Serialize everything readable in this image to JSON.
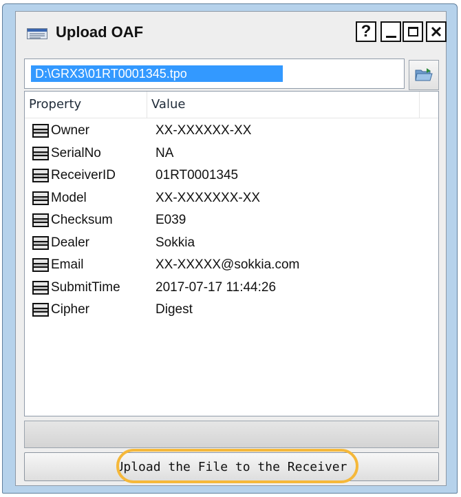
{
  "window": {
    "title": "Upload OAF",
    "help_glyph": "?",
    "icons": {
      "app": "window-icon",
      "help": "help-icon",
      "minimize": "minimize-icon",
      "maximize": "maximize-icon",
      "close": "close-icon",
      "browse": "folder-open-icon",
      "row": "property-icon"
    }
  },
  "file": {
    "path": "D:\\GRX3\\01RT0001345.tpo"
  },
  "table": {
    "columns": [
      "Property",
      "Value"
    ],
    "rows": [
      {
        "property": "Owner",
        "value": "XX-XXXXXX-XX"
      },
      {
        "property": "SerialNo",
        "value": "NA"
      },
      {
        "property": "ReceiverID",
        "value": "01RT0001345"
      },
      {
        "property": "Model",
        "value": "XX-XXXXXXX-XX"
      },
      {
        "property": "Checksum",
        "value": "E039"
      },
      {
        "property": "Dealer",
        "value": "Sokkia"
      },
      {
        "property": "Email",
        "value": "XX-XXXXX@sokkia.com"
      },
      {
        "property": "SubmitTime",
        "value": "2017-07-17 11:44:26"
      },
      {
        "property": "Cipher",
        "value": "Digest"
      }
    ]
  },
  "progress": {
    "fraction": 0
  },
  "actions": {
    "upload_label": "Upload the File to the Receiver"
  },
  "colors": {
    "frame": "#b6d2eb",
    "selection": "#3399ff",
    "highlight_ring": "#f5b83a"
  }
}
